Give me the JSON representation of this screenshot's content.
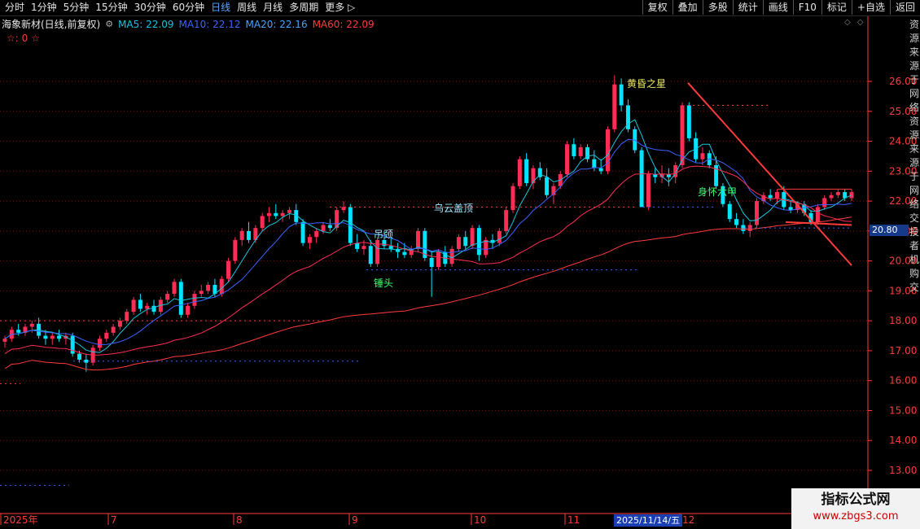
{
  "toolbar": {
    "left_items": [
      "分时",
      "1分钟",
      "5分钟",
      "15分钟",
      "30分钟",
      "60分钟",
      "日线",
      "周线",
      "月线",
      "多周期",
      "更多 ▷"
    ],
    "active_item": "日线",
    "right_buttons": [
      "复权",
      "叠加",
      "多股",
      "统计",
      "画线",
      "F10",
      "标记",
      "+自选",
      "返回"
    ]
  },
  "info": {
    "stock_name": "海象新材(日线,前复权)",
    "ma5": "MA5: 22.09",
    "ma10": "MA10: 22.12",
    "ma20": "MA20: 22.16",
    "ma60": "MA60: 22.09",
    "stars": "☆: 0 ☆"
  },
  "current_price": "20.80",
  "cursor_date": "2025/11/14/五",
  "right_strip": [
    "资",
    "源",
    "来",
    "源",
    "于",
    "网",
    "络",
    "资",
    "源",
    "来",
    "源",
    "于",
    "网",
    "络",
    "交",
    "投",
    "者",
    "机",
    "购",
    "交"
  ],
  "watermark": {
    "title": "指标公式网",
    "url": "www.zbgs3.com"
  },
  "colors": {
    "up": "#ff2d55",
    "down": "#00e5ff",
    "ma5": "#16c6e0",
    "ma10": "#3a63ff",
    "ma20": "#45a3ff",
    "ma60": "#ff3b3b",
    "axis": "#ff3b3b"
  },
  "chart_data": {
    "type": "candlestick",
    "title": "海象新材(日线,前复权)",
    "y_ticks": [
      "26.00",
      "25.00",
      "24.00",
      "23.00",
      "22.00",
      "21.00",
      "20.00",
      "19.00",
      "18.00",
      "17.00",
      "16.00",
      "15.00",
      "14.00",
      "13.00"
    ],
    "y_tick_values": [
      26,
      25,
      24,
      23,
      22,
      21,
      20,
      19,
      18,
      17,
      16,
      15,
      14,
      13
    ],
    "ylim": [
      12.3,
      26.5
    ],
    "x_labels": [
      "2025年",
      "7",
      "8",
      "9",
      "10",
      "11",
      "2025/11/14/五",
      "12"
    ],
    "annotations": [
      "黄昏之星",
      "乌云盖顶",
      "吊颈",
      "锤头",
      "身怀六甲"
    ],
    "candles_ohlc": [
      [
        17.3,
        17.5,
        17.1,
        17.4
      ],
      [
        17.4,
        17.8,
        17.3,
        17.7
      ],
      [
        17.7,
        17.9,
        17.5,
        17.6
      ],
      [
        17.6,
        17.9,
        17.5,
        17.8
      ],
      [
        17.8,
        18.0,
        17.6,
        17.9
      ],
      [
        17.9,
        18.1,
        17.4,
        17.5
      ],
      [
        17.5,
        17.7,
        17.2,
        17.4
      ],
      [
        17.4,
        17.6,
        17.2,
        17.5
      ],
      [
        17.5,
        17.7,
        17.3,
        17.4
      ],
      [
        17.4,
        17.6,
        17.2,
        17.5
      ],
      [
        17.5,
        17.6,
        16.8,
        16.9
      ],
      [
        16.9,
        17.0,
        16.6,
        16.7
      ],
      [
        16.7,
        16.9,
        16.3,
        16.6
      ],
      [
        16.6,
        17.2,
        16.5,
        17.1
      ],
      [
        17.1,
        17.5,
        17.0,
        17.4
      ],
      [
        17.4,
        17.7,
        17.3,
        17.6
      ],
      [
        17.6,
        17.9,
        17.5,
        17.8
      ],
      [
        17.8,
        18.1,
        17.7,
        18.0
      ],
      [
        18.0,
        18.4,
        17.9,
        18.3
      ],
      [
        18.3,
        18.8,
        18.2,
        18.7
      ],
      [
        18.7,
        18.9,
        18.3,
        18.4
      ],
      [
        18.4,
        18.6,
        18.2,
        18.5
      ],
      [
        18.5,
        18.7,
        18.2,
        18.3
      ],
      [
        18.3,
        18.8,
        18.2,
        18.7
      ],
      [
        18.7,
        19.0,
        18.6,
        18.9
      ],
      [
        18.9,
        19.4,
        18.8,
        19.3
      ],
      [
        19.3,
        19.4,
        18.1,
        18.2
      ],
      [
        18.2,
        18.6,
        18.1,
        18.5
      ],
      [
        18.5,
        19.0,
        18.4,
        18.9
      ],
      [
        18.9,
        19.2,
        18.8,
        19.0
      ],
      [
        19.0,
        19.3,
        18.9,
        19.2
      ],
      [
        19.2,
        19.4,
        18.8,
        18.9
      ],
      [
        18.9,
        19.5,
        18.8,
        19.4
      ],
      [
        19.4,
        20.1,
        19.3,
        20.0
      ],
      [
        20.0,
        20.8,
        19.9,
        20.7
      ],
      [
        20.7,
        21.1,
        20.5,
        21.0
      ],
      [
        21.0,
        21.3,
        20.6,
        20.7
      ],
      [
        20.7,
        21.2,
        20.6,
        21.1
      ],
      [
        21.1,
        21.6,
        21.0,
        21.5
      ],
      [
        21.5,
        21.8,
        21.3,
        21.6
      ],
      [
        21.6,
        21.9,
        21.4,
        21.5
      ],
      [
        21.5,
        21.7,
        21.3,
        21.6
      ],
      [
        21.6,
        21.8,
        21.4,
        21.7
      ],
      [
        21.7,
        21.9,
        21.2,
        21.3
      ],
      [
        21.3,
        21.4,
        20.5,
        20.6
      ],
      [
        20.6,
        20.9,
        20.4,
        20.8
      ],
      [
        20.8,
        21.1,
        20.6,
        21.0
      ],
      [
        21.0,
        21.3,
        20.9,
        21.2
      ],
      [
        21.2,
        21.4,
        21.0,
        21.1
      ],
      [
        21.1,
        21.8,
        21.0,
        21.7
      ],
      [
        21.7,
        22.0,
        21.6,
        21.8
      ],
      [
        21.8,
        21.9,
        20.5,
        20.6
      ],
      [
        20.6,
        20.9,
        20.3,
        20.4
      ],
      [
        20.4,
        20.7,
        20.2,
        20.5
      ],
      [
        20.5,
        20.7,
        19.8,
        19.9
      ],
      [
        19.9,
        20.8,
        19.8,
        20.7
      ],
      [
        20.7,
        21.0,
        20.4,
        20.5
      ],
      [
        20.5,
        20.8,
        20.3,
        20.4
      ],
      [
        20.4,
        20.6,
        20.1,
        20.3
      ],
      [
        20.3,
        20.6,
        20.1,
        20.2
      ],
      [
        20.2,
        20.5,
        20.1,
        20.4
      ],
      [
        20.4,
        21.1,
        20.3,
        21.0
      ],
      [
        21.0,
        21.1,
        20.0,
        20.1
      ],
      [
        20.1,
        20.3,
        18.8,
        19.8
      ],
      [
        19.8,
        20.4,
        19.7,
        20.3
      ],
      [
        20.3,
        20.5,
        19.8,
        19.9
      ],
      [
        19.9,
        20.5,
        19.8,
        20.4
      ],
      [
        20.4,
        20.9,
        20.3,
        20.8
      ],
      [
        20.8,
        21.0,
        20.4,
        20.5
      ],
      [
        20.5,
        21.2,
        20.4,
        21.1
      ],
      [
        21.1,
        21.2,
        20.0,
        20.2
      ],
      [
        20.2,
        20.8,
        20.1,
        20.7
      ],
      [
        20.7,
        20.9,
        20.4,
        20.6
      ],
      [
        20.6,
        21.1,
        20.5,
        21.0
      ],
      [
        21.0,
        21.8,
        20.9,
        21.7
      ],
      [
        21.7,
        22.6,
        21.6,
        22.5
      ],
      [
        22.5,
        23.5,
        22.4,
        23.4
      ],
      [
        23.4,
        23.6,
        22.5,
        22.6
      ],
      [
        22.6,
        23.2,
        22.4,
        23.1
      ],
      [
        23.1,
        23.3,
        22.7,
        22.8
      ],
      [
        22.8,
        23.1,
        22.1,
        22.2
      ],
      [
        22.2,
        22.6,
        21.9,
        22.5
      ],
      [
        22.5,
        23.0,
        22.4,
        22.9
      ],
      [
        22.9,
        24.0,
        22.8,
        23.9
      ],
      [
        23.9,
        24.1,
        23.4,
        23.5
      ],
      [
        23.5,
        23.9,
        23.4,
        23.8
      ],
      [
        23.8,
        23.9,
        23.3,
        23.4
      ],
      [
        23.4,
        23.7,
        23.0,
        23.1
      ],
      [
        23.1,
        23.4,
        22.9,
        23.0
      ],
      [
        23.0,
        24.5,
        22.9,
        24.4
      ],
      [
        24.4,
        26.2,
        24.3,
        25.9
      ],
      [
        25.9,
        26.1,
        25.0,
        25.2
      ],
      [
        25.2,
        25.4,
        24.3,
        24.4
      ],
      [
        24.4,
        24.5,
        23.6,
        23.7
      ],
      [
        23.7,
        23.8,
        21.8,
        21.8
      ],
      [
        21.8,
        23.0,
        21.7,
        22.9
      ],
      [
        22.9,
        23.1,
        22.6,
        22.8
      ],
      [
        22.8,
        23.2,
        22.6,
        22.9
      ],
      [
        22.9,
        23.1,
        22.5,
        22.8
      ],
      [
        22.8,
        23.3,
        22.6,
        23.2
      ],
      [
        23.2,
        25.3,
        23.1,
        25.2
      ],
      [
        25.2,
        25.3,
        24.0,
        24.1
      ],
      [
        24.1,
        24.3,
        23.3,
        23.4
      ],
      [
        23.4,
        23.8,
        23.2,
        23.6
      ],
      [
        23.6,
        23.7,
        23.1,
        23.2
      ],
      [
        23.2,
        23.5,
        22.4,
        22.5
      ],
      [
        22.5,
        22.6,
        21.8,
        21.9
      ],
      [
        21.9,
        22.0,
        21.3,
        21.4
      ],
      [
        21.4,
        21.6,
        21.1,
        21.2
      ],
      [
        21.2,
        21.4,
        20.9,
        21.0
      ],
      [
        21.0,
        21.3,
        20.8,
        21.2
      ],
      [
        21.2,
        22.1,
        21.1,
        22.0
      ],
      [
        22.0,
        22.3,
        21.9,
        22.2
      ],
      [
        22.2,
        22.4,
        22.0,
        22.1
      ],
      [
        22.1,
        22.4,
        21.9,
        22.3
      ],
      [
        22.3,
        22.5,
        21.7,
        21.8
      ],
      [
        21.8,
        22.0,
        21.6,
        21.7
      ],
      [
        21.7,
        22.0,
        21.6,
        21.9
      ],
      [
        21.9,
        22.0,
        21.5,
        21.6
      ],
      [
        21.6,
        21.7,
        21.2,
        21.3
      ],
      [
        21.3,
        21.9,
        21.2,
        21.8
      ],
      [
        21.8,
        22.2,
        21.7,
        22.1
      ],
      [
        22.1,
        22.3,
        22.0,
        22.2
      ],
      [
        22.2,
        22.4,
        22.1,
        22.3
      ],
      [
        22.3,
        22.4,
        22.0,
        22.1
      ],
      [
        22.1,
        22.4,
        22.0,
        22.3
      ]
    ]
  }
}
